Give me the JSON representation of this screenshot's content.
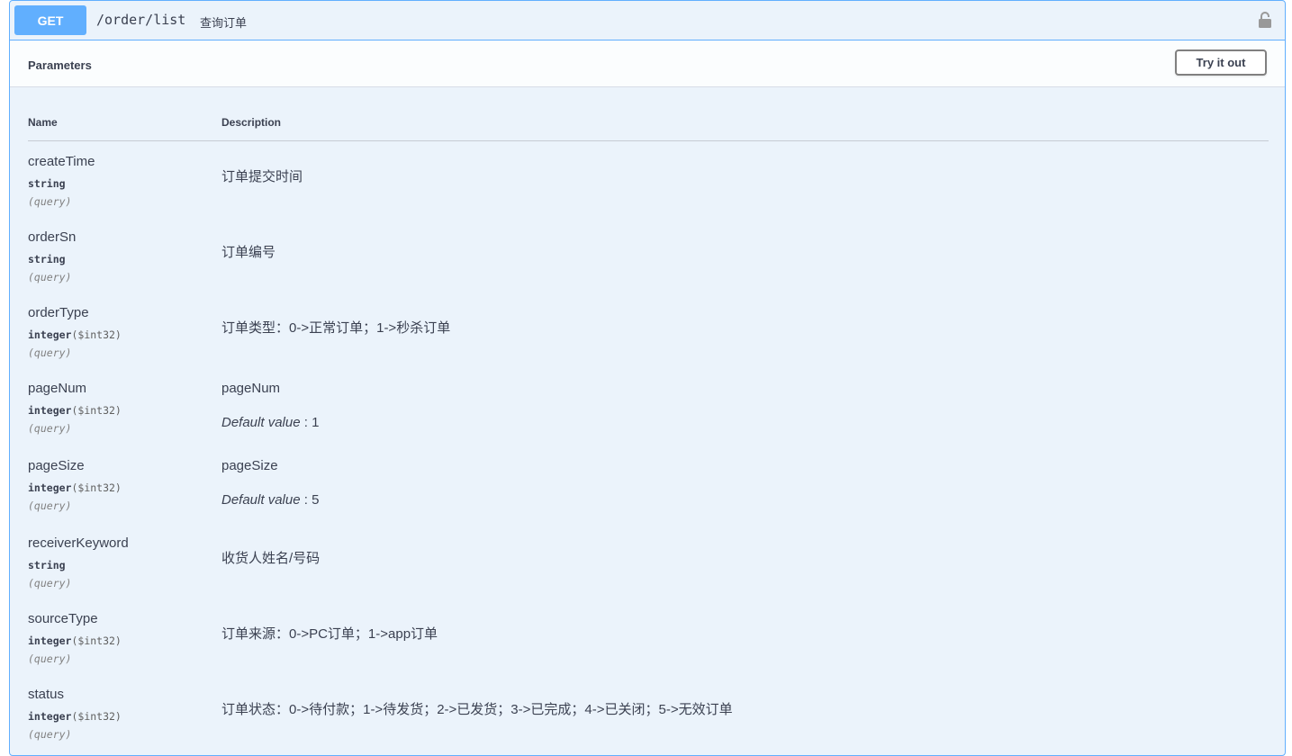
{
  "operation": {
    "method": "GET",
    "path": "/order/list",
    "summary": "查询订单"
  },
  "parameters_section": {
    "title": "Parameters",
    "try_label": "Try it out"
  },
  "table": {
    "col_name": "Name",
    "col_desc": "Description"
  },
  "params": [
    {
      "name": "createTime",
      "type": "string",
      "format": "",
      "in": "(query)",
      "desc": "订单提交时间"
    },
    {
      "name": "orderSn",
      "type": "string",
      "format": "",
      "in": "(query)",
      "desc": "订单编号"
    },
    {
      "name": "orderType",
      "type": "integer",
      "format": "($int32)",
      "in": "(query)",
      "desc": "订单类型：0->正常订单；1->秒杀订单"
    },
    {
      "name": "pageNum",
      "type": "integer",
      "format": "($int32)",
      "in": "(query)",
      "desc": "pageNum",
      "default_label": "Default value",
      "default_value": " : 1"
    },
    {
      "name": "pageSize",
      "type": "integer",
      "format": "($int32)",
      "in": "(query)",
      "desc": "pageSize",
      "default_label": "Default value",
      "default_value": " : 5"
    },
    {
      "name": "receiverKeyword",
      "type": "string",
      "format": "",
      "in": "(query)",
      "desc": "收货人姓名/号码"
    },
    {
      "name": "sourceType",
      "type": "integer",
      "format": "($int32)",
      "in": "(query)",
      "desc": "订单来源：0->PC订单；1->app订单"
    },
    {
      "name": "status",
      "type": "integer",
      "format": "($int32)",
      "in": "(query)",
      "desc": "订单状态：0->待付款；1->待发货；2->已发货；3->已完成；4->已关闭；5->无效订单"
    }
  ],
  "colors": {
    "accent": "#61affe",
    "background": "#ebf3fb"
  },
  "icons": {
    "lock": "lock-icon"
  }
}
